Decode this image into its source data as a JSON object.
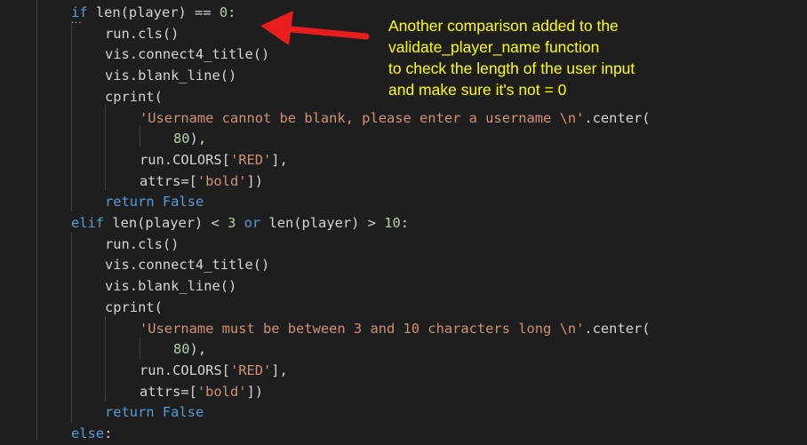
{
  "editor": {
    "lines": [
      {
        "indent": 80,
        "tokens": [
          [
            "kw",
            "if"
          ],
          [
            "op",
            " len(player) == "
          ],
          [
            "num",
            "0"
          ],
          [
            "op",
            ":"
          ]
        ]
      },
      {
        "indent": 118,
        "tokens": [
          [
            "op",
            "run.cls()"
          ]
        ]
      },
      {
        "indent": 118,
        "tokens": [
          [
            "op",
            "vis.connect4_title()"
          ]
        ]
      },
      {
        "indent": 118,
        "tokens": [
          [
            "op",
            "vis.blank_line()"
          ]
        ]
      },
      {
        "indent": 118,
        "tokens": [
          [
            "op",
            "cprint("
          ]
        ]
      },
      {
        "indent": 157,
        "tokens": [
          [
            "str",
            "'Username cannot be blank, please enter a username \\n'"
          ],
          [
            "op",
            ".center("
          ]
        ]
      },
      {
        "indent": 195,
        "tokens": [
          [
            "num",
            "80"
          ],
          [
            "op",
            "),"
          ]
        ]
      },
      {
        "indent": 157,
        "tokens": [
          [
            "op",
            "run.COLORS["
          ],
          [
            "str",
            "'RED'"
          ],
          [
            "op",
            "],"
          ]
        ]
      },
      {
        "indent": 157,
        "tokens": [
          [
            "op",
            "attrs=["
          ],
          [
            "str",
            "'bold'"
          ],
          [
            "op",
            "])"
          ]
        ]
      },
      {
        "indent": 118,
        "tokens": [
          [
            "kw",
            "return"
          ],
          [
            "op",
            " "
          ],
          [
            "kw",
            "False"
          ]
        ]
      },
      {
        "indent": 80,
        "tokens": [
          [
            "kw",
            "elif"
          ],
          [
            "op",
            " len(player) < "
          ],
          [
            "num",
            "3"
          ],
          [
            "op",
            " "
          ],
          [
            "kw",
            "or"
          ],
          [
            "op",
            " len(player) > "
          ],
          [
            "num",
            "10"
          ],
          [
            "op",
            ":"
          ]
        ]
      },
      {
        "indent": 118,
        "tokens": [
          [
            "op",
            "run.cls()"
          ]
        ]
      },
      {
        "indent": 118,
        "tokens": [
          [
            "op",
            "vis.connect4_title()"
          ]
        ]
      },
      {
        "indent": 118,
        "tokens": [
          [
            "op",
            "vis.blank_line()"
          ]
        ]
      },
      {
        "indent": 118,
        "tokens": [
          [
            "op",
            "cprint("
          ]
        ]
      },
      {
        "indent": 157,
        "tokens": [
          [
            "str",
            "'Username must be between 3 and 10 characters long \\n'"
          ],
          [
            "op",
            ".center("
          ]
        ]
      },
      {
        "indent": 195,
        "tokens": [
          [
            "num",
            "80"
          ],
          [
            "op",
            "),"
          ]
        ]
      },
      {
        "indent": 157,
        "tokens": [
          [
            "op",
            "run.COLORS["
          ],
          [
            "str",
            "'RED'"
          ],
          [
            "op",
            "],"
          ]
        ]
      },
      {
        "indent": 157,
        "tokens": [
          [
            "op",
            "attrs=["
          ],
          [
            "str",
            "'bold'"
          ],
          [
            "op",
            "])"
          ]
        ]
      },
      {
        "indent": 118,
        "tokens": [
          [
            "kw",
            "return"
          ],
          [
            "op",
            " "
          ],
          [
            "kw",
            "False"
          ]
        ]
      },
      {
        "indent": 80,
        "tokens": [
          [
            "kw",
            "else"
          ],
          [
            "op",
            ":"
          ]
        ]
      }
    ]
  },
  "annotation": {
    "lines": [
      "Another comparison added to the",
      "validate_player_name function",
      "to check the length of the user input",
      "and make sure it's not = 0"
    ],
    "color": "#ffff00",
    "arrow_color": "#e81e1e"
  },
  "colors": {
    "background": "#1e1e1e",
    "keyword": "#569cd6",
    "number": "#b5cea8",
    "string": "#ce9178",
    "text": "#d4d4d4"
  }
}
